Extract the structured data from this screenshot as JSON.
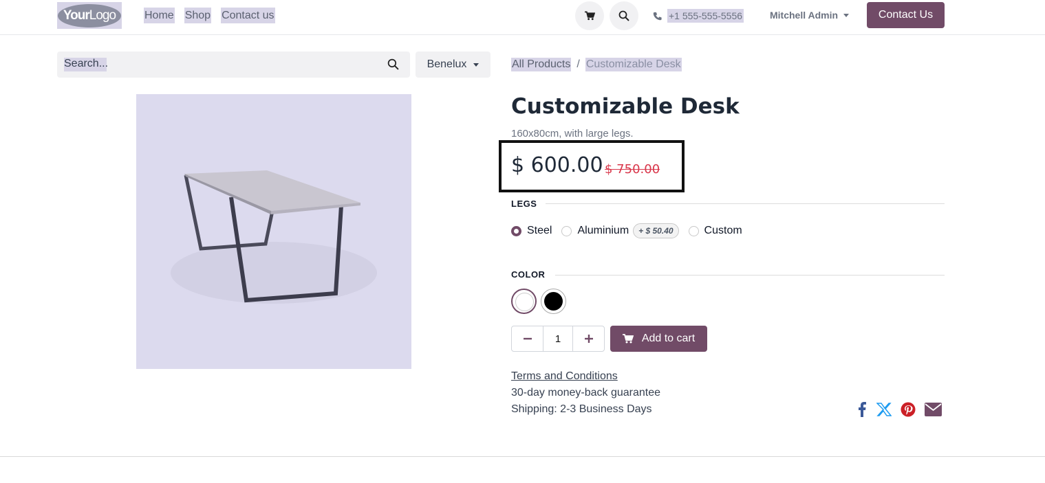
{
  "header": {
    "logo": {
      "bold": "Your",
      "thin": "Logo"
    },
    "nav": [
      "Home",
      "Shop",
      "Contact us"
    ],
    "phone": "+1 555-555-5556",
    "user": "Mitchell Admin",
    "contact_button": "Contact Us"
  },
  "search": {
    "placeholder": "Search...",
    "pricelist": "Benelux"
  },
  "breadcrumb": {
    "parent": "All Products",
    "separator": "/",
    "current": "Customizable Desk"
  },
  "product": {
    "name": "Customizable Desk",
    "description": "160x80cm, with large legs.",
    "price": "$ 600.00",
    "old_price": "$ 750.00",
    "legs_label": "LEGS",
    "legs_options": [
      {
        "label": "Steel",
        "checked": true
      },
      {
        "label": "Aluminium",
        "extra": "+ $ 50.40"
      },
      {
        "label": "Custom"
      }
    ],
    "color_label": "COLOR",
    "colors": [
      "#ffffff",
      "#000000"
    ],
    "quantity": "1",
    "add_to_cart": "Add to cart",
    "terms": "Terms and Conditions",
    "guarantee": "30-day money-back guarantee",
    "shipping": "Shipping: 2-3 Business Days"
  },
  "colors": {
    "primary": "#714b67",
    "strike": "#d9374b",
    "highlight": "#d7d4e7"
  },
  "social_icons": [
    "facebook-icon",
    "x-twitter-icon",
    "pinterest-icon",
    "email-icon"
  ]
}
